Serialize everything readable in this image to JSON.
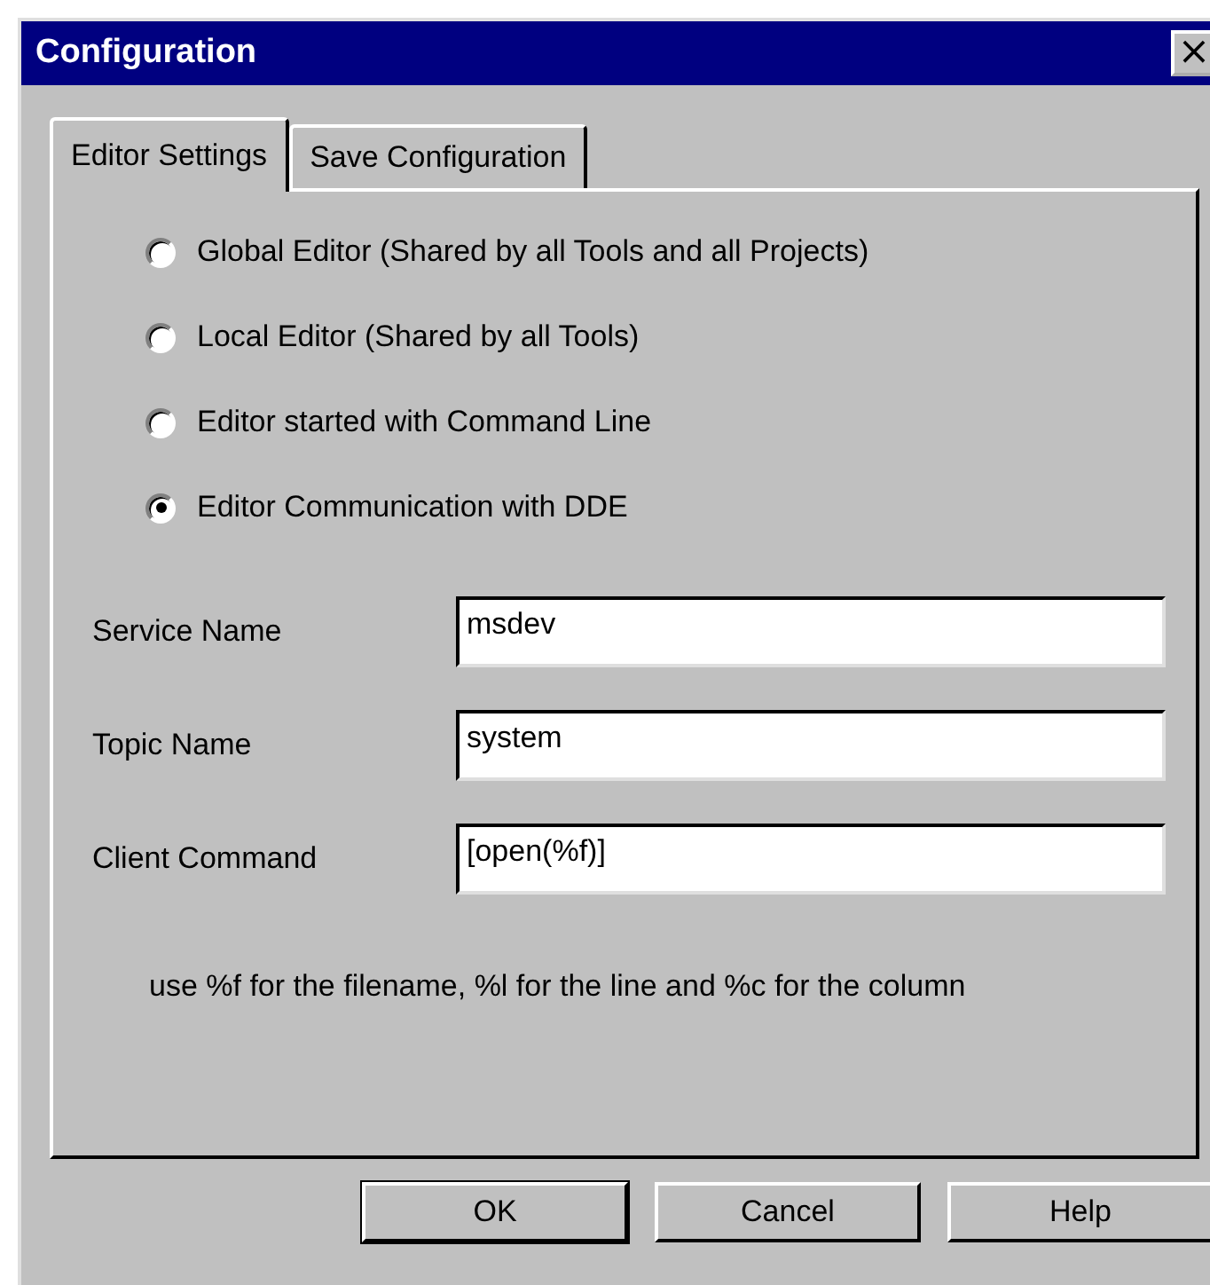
{
  "window": {
    "title": "Configuration",
    "close": "×"
  },
  "tabs": [
    {
      "label": "Editor Settings",
      "selected": true
    },
    {
      "label": "Save Configuration",
      "selected": false
    }
  ],
  "editor_options": [
    {
      "label": "Global Editor (Shared by all Tools and all Projects)",
      "selected": false
    },
    {
      "label": "Local Editor (Shared by all Tools)",
      "selected": false
    },
    {
      "label": "Editor started with Command Line",
      "selected": false
    },
    {
      "label": "Editor Communication with DDE",
      "selected": true
    }
  ],
  "fields": [
    {
      "label": "Service Name",
      "value": "msdev"
    },
    {
      "label": "Topic Name",
      "value": "system"
    },
    {
      "label": "Client Command",
      "value": "[open(%f)]"
    }
  ],
  "hint": "use %f for the filename, %l for the line and %c for the column",
  "buttons": [
    {
      "label": "OK",
      "default": true
    },
    {
      "label": "Cancel",
      "default": false
    },
    {
      "label": "Help",
      "default": false
    }
  ]
}
